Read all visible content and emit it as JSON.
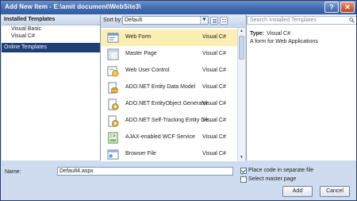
{
  "window": {
    "title": "Add New Item - E:\\amit document\\WebSite3\\"
  },
  "left_panel": {
    "header": "Installed Templates",
    "items": [
      "Visual Basic",
      "Visual C#"
    ],
    "online": "Online Templates"
  },
  "toolbar": {
    "sort_label": "Sort by:",
    "sort_value": "Default"
  },
  "search": {
    "placeholder": "Search Installed Templates"
  },
  "templates": [
    {
      "name": "Web Form",
      "lang": "Visual C#",
      "icon": "web-form-icon"
    },
    {
      "name": "Master Page",
      "lang": "Visual C#",
      "icon": "master-page-icon"
    },
    {
      "name": "Web User Control",
      "lang": "Visual C#",
      "icon": "web-user-control-icon"
    },
    {
      "name": "ADO.NET Entity Data Model",
      "lang": "Visual C#",
      "icon": "entity-model-icon"
    },
    {
      "name": "ADO.NET EntityObject Generator",
      "lang": "Visual C#",
      "icon": "generator-icon"
    },
    {
      "name": "ADO.NET Self-Tracking Entity Ge...",
      "lang": "Visual C#",
      "icon": "generator-icon"
    },
    {
      "name": "AJAX-enabled WCF Service",
      "lang": "Visual C#",
      "icon": "wcf-service-icon"
    },
    {
      "name": "Browser File",
      "lang": "Visual C#",
      "icon": "browser-file-icon"
    }
  ],
  "details": {
    "type_label": "Type:",
    "type_value": "Visual C#",
    "description": "A form for Web Applications"
  },
  "footer": {
    "name_label": "Name:",
    "name_value": "Default4.aspx",
    "place_code": "Place code in separate file",
    "place_code_checked": true,
    "select_master": "Select master page",
    "select_master_checked": false,
    "add": "Add",
    "cancel": "Cancel"
  }
}
